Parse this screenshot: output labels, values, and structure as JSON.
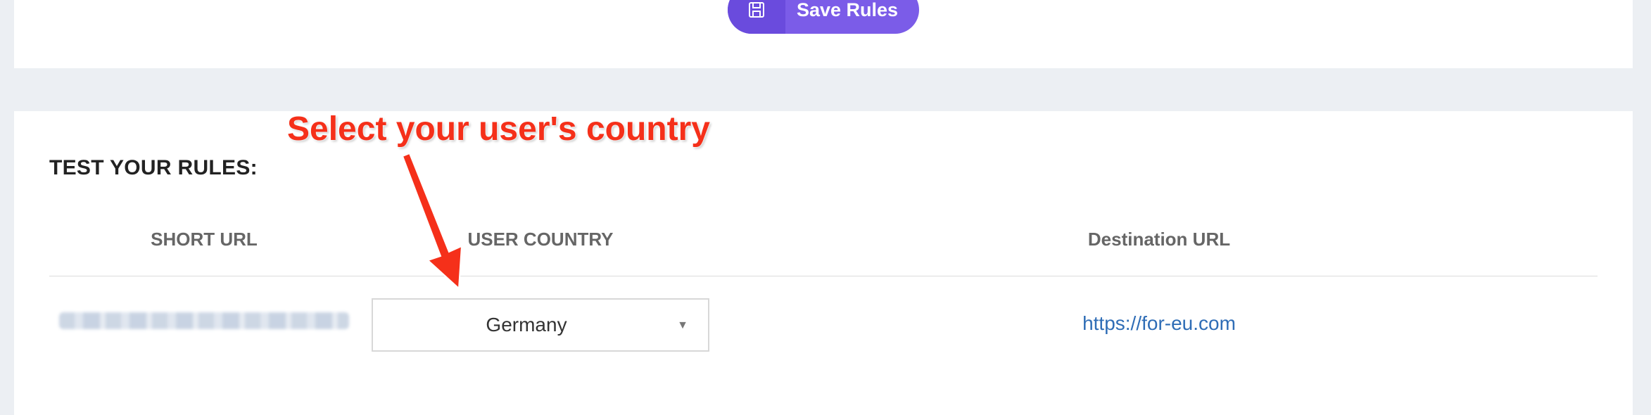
{
  "toolbar": {
    "save_label": "Save Rules",
    "save_icon": "floppy-disk-icon",
    "accent_color": "#7b5ce8"
  },
  "annotation": {
    "text": "Select your user's country",
    "color": "#f5301a"
  },
  "test_section": {
    "title": "TEST YOUR RULES:",
    "columns": {
      "short_url": "SHORT URL",
      "user_country": "USER COUNTRY",
      "destination_url": "Destination URL"
    },
    "row": {
      "short_url": "",
      "country": "Germany",
      "destination": "https://for-eu.com"
    }
  }
}
